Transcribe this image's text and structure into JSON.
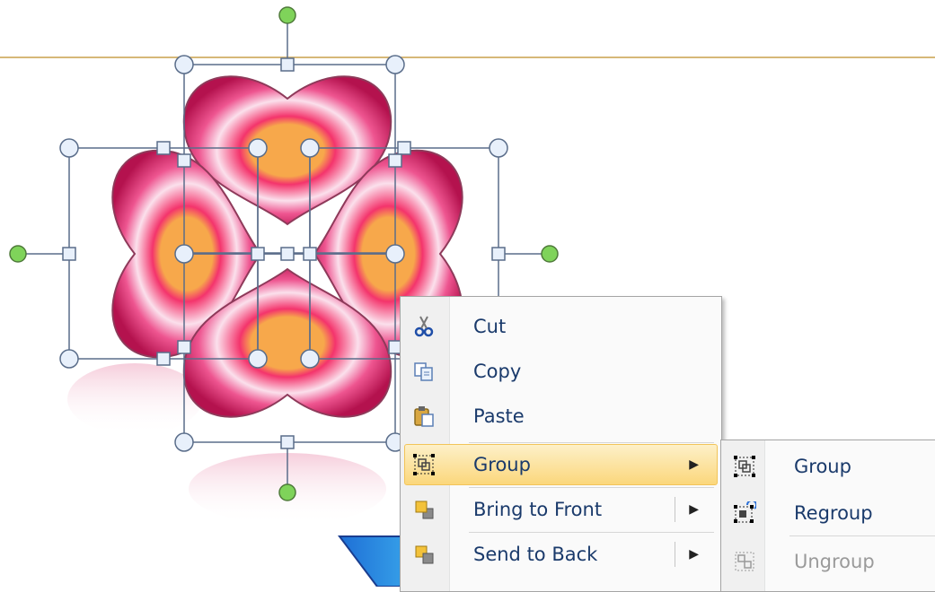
{
  "context_menu": {
    "items": [
      {
        "label": "Cut",
        "icon": "scissors-icon"
      },
      {
        "label": "Copy",
        "icon": "copy-icon"
      },
      {
        "label": "Paste",
        "icon": "paste-icon"
      },
      {
        "label": "Group",
        "icon": "group-icon",
        "has_submenu": true,
        "highlighted": true
      },
      {
        "label": "Bring to Front",
        "icon": "bring-to-front-icon",
        "has_submenu": true
      },
      {
        "label": "Send to Back",
        "icon": "send-to-back-icon",
        "has_submenu": true
      }
    ]
  },
  "group_submenu": {
    "items": [
      {
        "label": "Group",
        "icon": "group-icon",
        "enabled": true
      },
      {
        "label": "Regroup",
        "icon": "regroup-icon",
        "enabled": true
      },
      {
        "label": "Ungroup",
        "icon": "ungroup-icon",
        "enabled": false
      }
    ]
  },
  "colors": {
    "petal_outer": "#c2185b",
    "petal_inner": "#ffffff",
    "flower_center": "#f7a84b",
    "menu_highlight": "#fbd77c",
    "handle_rotation": "#7fd35a",
    "selection_line": "#5a6d8a",
    "text": "#1a3a6b"
  }
}
